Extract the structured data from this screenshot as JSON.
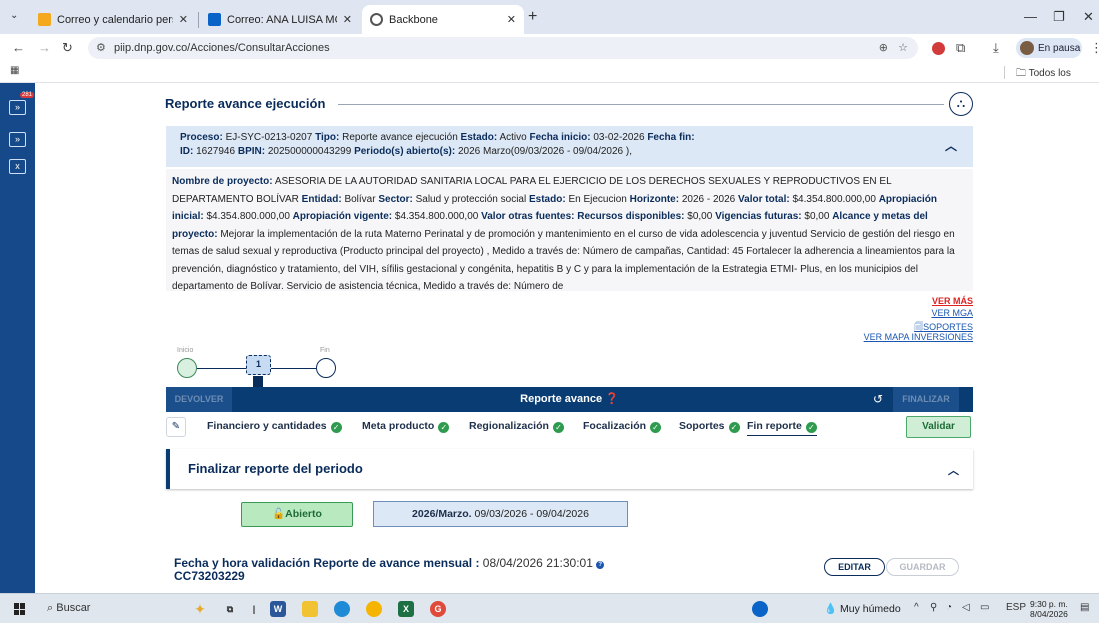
{
  "browser": {
    "tabs": [
      {
        "title": "Correo y calendario personal de",
        "favicon_color": "#f4a81d"
      },
      {
        "title": "Correo: ANA LUISA MORELOS C",
        "favicon_color": "#0a64c8"
      },
      {
        "title": "Backbone",
        "favicon_color": "#555555"
      }
    ],
    "url": "piip.dnp.gov.co/Acciones/ConsultarAcciones",
    "profile_status": "En pausa",
    "bookmarks_label": "Todos los favoritos"
  },
  "rail": {
    "badge": "281"
  },
  "page": {
    "section_title": "Reporte avance ejecución",
    "header": {
      "proceso_label": "Proceso:",
      "proceso": "EJ-SYC-0213-0207",
      "tipo_label": "Tipo:",
      "tipo": "Reporte avance ejecución",
      "estado_label": "Estado:",
      "estado": "Activo",
      "fecha_inicio_label": "Fecha inicio:",
      "fecha_inicio": "03-02-2026",
      "fecha_fin_label": "Fecha fin:",
      "id_label": "ID:",
      "id": "1627946",
      "bpin_label": "BPIN:",
      "bpin": "202500000043299",
      "periodo_label": "Periodo(s) abierto(s):",
      "periodo": "2026 Marzo(09/03/2026 - 09/04/2026 ),"
    },
    "details": {
      "nombre_label": "Nombre de proyecto:",
      "nombre": "ASESORIA DE LA AUTORIDAD SANITARIA LOCAL PARA EL EJERCICIO DE LOS DERECHOS SEXUALES Y REPRODUCTIVOS EN EL DEPARTAMENTO BOLÍVAR",
      "entidad_label": "Entidad:",
      "entidad": "Bolívar",
      "sector_label": "Sector:",
      "sector": "Salud y protección social",
      "estado_label": "Estado:",
      "estado": "En Ejecucion",
      "horizonte_label": "Horizonte:",
      "horizonte": "2026 - 2026",
      "valor_total_label": "Valor total:",
      "valor_total": "$4.354.800.000,00",
      "aprop_ini_label": "Apropiación inicial:",
      "aprop_ini": "$4.354.800.000,00",
      "aprop_vig_label": "Apropiación vigente:",
      "aprop_vig": "$4.354.800.000,00",
      "otras_label": "Valor otras fuentes:",
      "disp_label": "Recursos disponibles:",
      "disp": "$0,00",
      "futuras_label": "Vigencias futuras:",
      "futuras": "$0,00",
      "alcance_label": "Alcance y metas del proyecto:",
      "alcance": "Mejorar la implementación de la ruta Materno Perinatal y de promoción y mantenimiento en el curso de vida adolescencia y juventud Servicio de gestión del riesgo en temas de salud sexual y reproductiva (Producto principal del proyecto) , Medido a través de: Número de campañas, Cantidad: 45 Fortalecer la adherencia a lineamientos para la prevención, diagnóstico y tratamiento, del VIH, sífilis gestacional y congénita, hepatitis B y C y para la implementación de la Estrategia ETMI- Plus, en los municipios del departamento de Bolívar. Servicio de asistencia técnica, Medido a través de: Número de"
    },
    "links": {
      "ver_mas": "VER MÁS",
      "ver_mga": "VER MGA",
      "soportes": "SOPORTES",
      "ver_mapa": "VER MAPA INVERSIONES"
    },
    "workflow": {
      "start_label": "Inicio",
      "end_label": "Fin",
      "step": "1"
    },
    "actionbar": {
      "devolver": "DEVOLVER",
      "title": "Reporte avance ❓",
      "finalizar": "FINALIZAR"
    },
    "steps": [
      "Financiero y cantidades",
      "Meta producto",
      "Regionalización",
      "Focalización",
      "Soportes",
      "Fin reporte"
    ],
    "validar": "Validar",
    "panel_title": "Finalizar reporte del periodo",
    "status": "Abierto",
    "period_bold": "2026/Marzo.",
    "period_range": "09/03/2026 - 09/04/2026",
    "validation_label": "Fecha y hora validación Reporte de avance mensual :",
    "validation_value": "08/04/2026 21:30:01",
    "validation_user": "CC73203229",
    "edit": "EDITAR",
    "save": "GUARDAR"
  },
  "taskbar": {
    "search": "Buscar",
    "weather": "Muy húmedo",
    "lang": "ESP",
    "time": "9:30 p. m.",
    "date": "8/04/2026"
  }
}
